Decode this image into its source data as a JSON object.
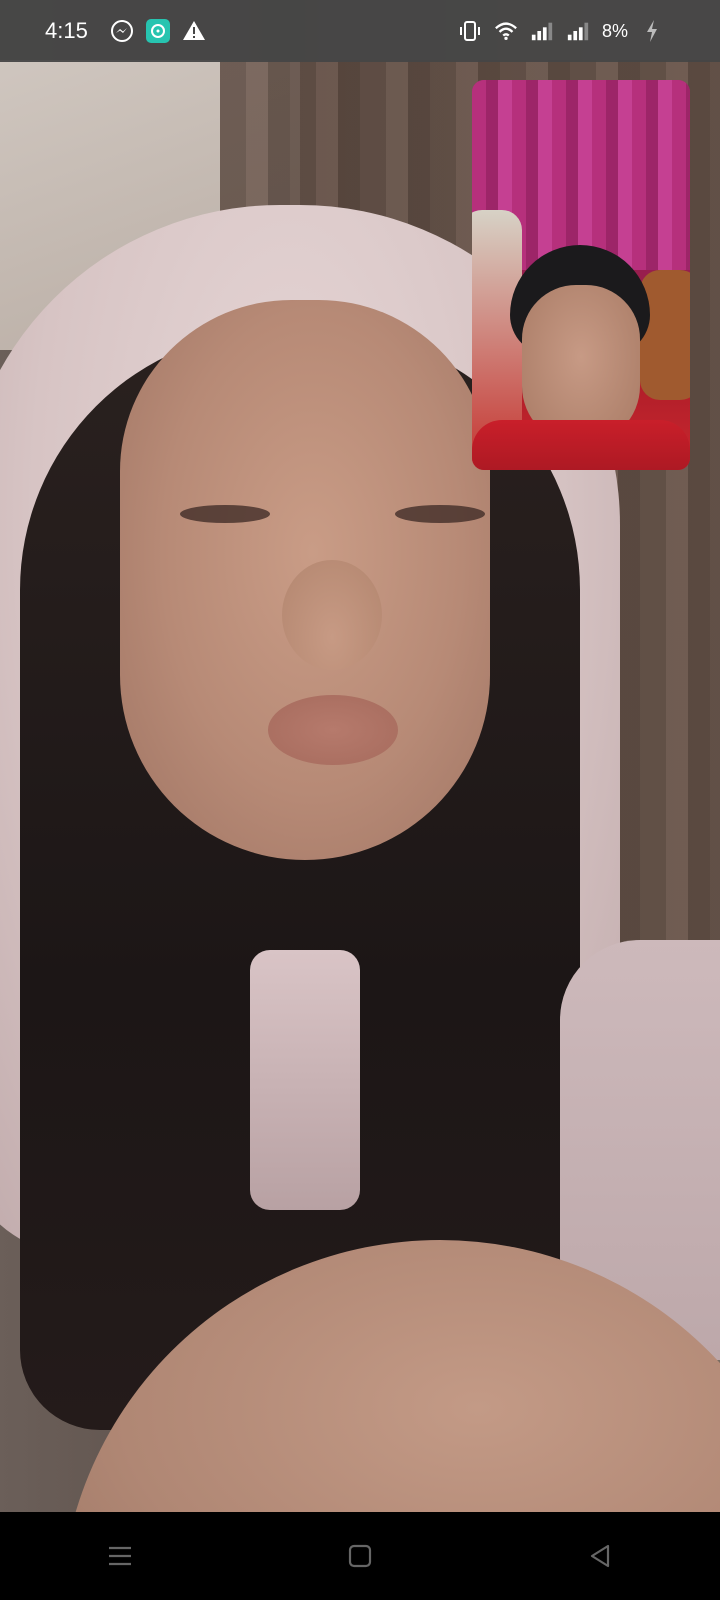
{
  "status_bar": {
    "time": "4:15",
    "left_icons": [
      "messenger-icon",
      "chat-app-icon",
      "warning-icon"
    ],
    "right_icons": [
      "vibrate-icon",
      "wifi-icon",
      "signal-icon",
      "signal-icon-2"
    ],
    "battery_text": "8%",
    "charging": true
  },
  "call": {
    "remote_video": "remote-participant-video",
    "local_preview": "self-view-preview"
  },
  "nav_bar": {
    "buttons": [
      "recent-apps-icon",
      "home-icon",
      "back-icon"
    ]
  },
  "colors": {
    "status_bar_bg": "#464646",
    "nav_bar_bg": "#000000",
    "chat_app_icon": "#27c4b0"
  }
}
